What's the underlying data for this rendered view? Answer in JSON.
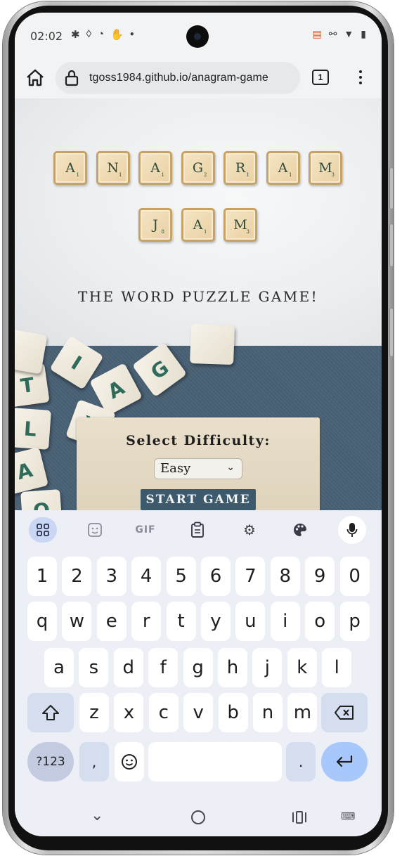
{
  "status_bar": {
    "time": "02:02",
    "left_icons": [
      "gear-icon",
      "shield-icon",
      "face-icon",
      "hand-icon",
      "dot-icon"
    ],
    "right_icons": [
      "cast-icon",
      "link-icon",
      "wifi-icon",
      "battery-icon"
    ]
  },
  "browser": {
    "url": "tgoss1984.github.io/anagram-game",
    "tab_count": "1"
  },
  "page": {
    "title_row1": [
      {
        "letter": "A",
        "points": "1"
      },
      {
        "letter": "N",
        "points": "1"
      },
      {
        "letter": "A",
        "points": "1"
      },
      {
        "letter": "G",
        "points": "2"
      },
      {
        "letter": "R",
        "points": "1"
      },
      {
        "letter": "A",
        "points": "1"
      },
      {
        "letter": "M",
        "points": "3"
      }
    ],
    "title_row2": [
      {
        "letter": "J",
        "points": "8"
      },
      {
        "letter": "A",
        "points": "1"
      },
      {
        "letter": "M",
        "points": "3"
      }
    ],
    "tagline": "THE WORD PUZZLE GAME!",
    "difficulty_label": "Select Difficulty:",
    "difficulty_value": "Easy",
    "start_button": "START GAME"
  },
  "keyboard": {
    "toolbar": [
      "apps-icon",
      "sticker-icon",
      "GIF",
      "clipboard-icon",
      "settings-icon",
      "palette-icon",
      "mic-icon"
    ],
    "row_numbers": [
      "1",
      "2",
      "3",
      "4",
      "5",
      "6",
      "7",
      "8",
      "9",
      "0"
    ],
    "row_1": [
      "q",
      "w",
      "e",
      "r",
      "t",
      "y",
      "u",
      "i",
      "o",
      "p"
    ],
    "row_2": [
      "a",
      "s",
      "d",
      "f",
      "g",
      "h",
      "j",
      "k",
      "l"
    ],
    "row_3": [
      "z",
      "x",
      "c",
      "v",
      "b",
      "n",
      "m"
    ],
    "symbols_key": "?123",
    "comma_key": ",",
    "period_key": "."
  },
  "colors": {
    "tile_face": "#ecd6ab",
    "tile_border": "#c7a265",
    "board": "#4a6275",
    "start_button": "#3d5a6c",
    "keyboard_bg": "#edeff7",
    "enter_key": "#a8c7fa"
  }
}
